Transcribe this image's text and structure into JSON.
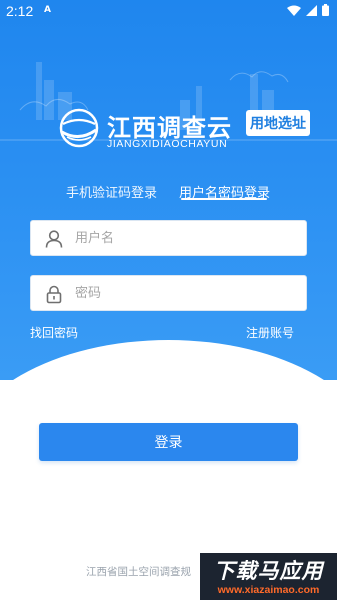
{
  "status_bar": {
    "time": "2:12",
    "notification_letter": "A",
    "icons": [
      "wifi-icon",
      "signal-icon",
      "battery-icon"
    ]
  },
  "logo": {
    "title": "江西调查云",
    "subtitle": "JIANGXIDIAOCHAYUN",
    "badge": "用地选址"
  },
  "tabs": [
    {
      "label": "手机验证码登录",
      "active": false
    },
    {
      "label": "用户名密码登录",
      "active": true
    }
  ],
  "form": {
    "username_placeholder": "用户名",
    "password_placeholder": "密码",
    "username_value": "",
    "password_value": ""
  },
  "links": {
    "forgot": "找回密码",
    "register": "注册账号"
  },
  "login_button": "登录",
  "footer": "江西省国土空间调查规",
  "watermark": {
    "title": "下载马应用",
    "url": "www.xiazaimao.com"
  },
  "colors": {
    "primary": "#1f86ee",
    "button": "#2b87ee",
    "footer_text": "#9aa3ad",
    "watermark_accent": "#ff6a2a"
  }
}
